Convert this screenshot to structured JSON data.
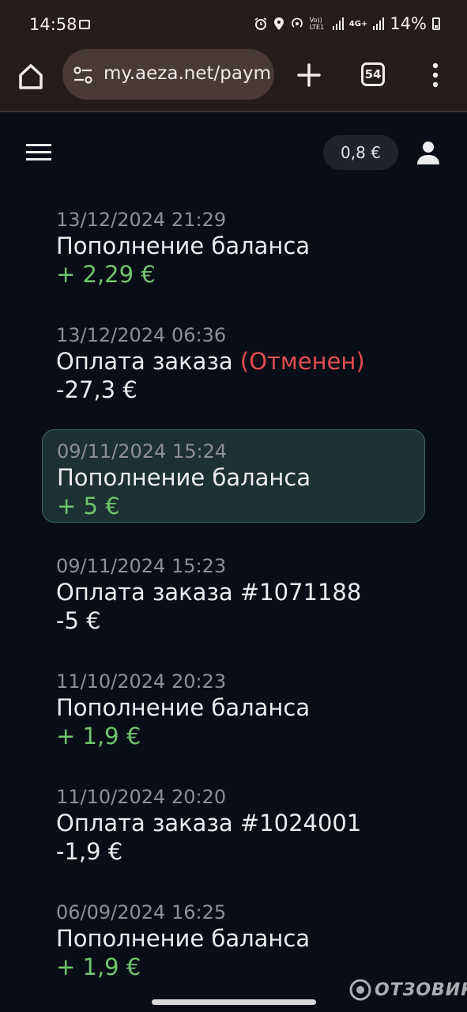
{
  "status_bar": {
    "time": "14:58",
    "battery": "14%",
    "icons": [
      "screenshot-icon",
      "alarm-icon",
      "location-icon",
      "hotspot-icon",
      "volte-icon",
      "signal-icon",
      "4g-icon",
      "signal-icon",
      "battery-icon"
    ],
    "volte_label": "Vo)) LTE1",
    "network_label": "4G+"
  },
  "browser": {
    "url": "my.aeza.net/paym",
    "tab_count": "54"
  },
  "header": {
    "balance": "0,8 €"
  },
  "transactions": [
    {
      "date": "13/12/2024 21:29",
      "title": "Пополнение баланса",
      "status": "",
      "amount": "+ 2,29 €",
      "kind": "pos"
    },
    {
      "date": "13/12/2024 06:36",
      "title": "Оплата заказа",
      "status": "(Отменен)",
      "amount": "-27,3 €",
      "kind": "neg"
    },
    {
      "date": "09/11/2024 15:24",
      "title": "Пополнение баланса",
      "status": "",
      "amount": "+ 5 €",
      "kind": "pos"
    },
    {
      "date": "09/11/2024 15:23",
      "title": "Оплата заказа #1071188",
      "status": "",
      "amount": "-5 €",
      "kind": "neg"
    },
    {
      "date": "11/10/2024 20:23",
      "title": "Пополнение баланса",
      "status": "",
      "amount": "+ 1,9 €",
      "kind": "pos"
    },
    {
      "date": "11/10/2024 20:20",
      "title": "Оплата заказа #1024001",
      "status": "",
      "amount": "-1,9 €",
      "kind": "neg"
    },
    {
      "date": "06/09/2024 16:25",
      "title": "Пополнение баланса",
      "status": "",
      "amount": "+ 1,9 €",
      "kind": "pos"
    }
  ],
  "watermark": "ОТЗОВИК",
  "colors": {
    "background": "#090d16",
    "positive": "#72c56f",
    "cancelled": "#e24d52",
    "highlight": "#1c3131"
  }
}
